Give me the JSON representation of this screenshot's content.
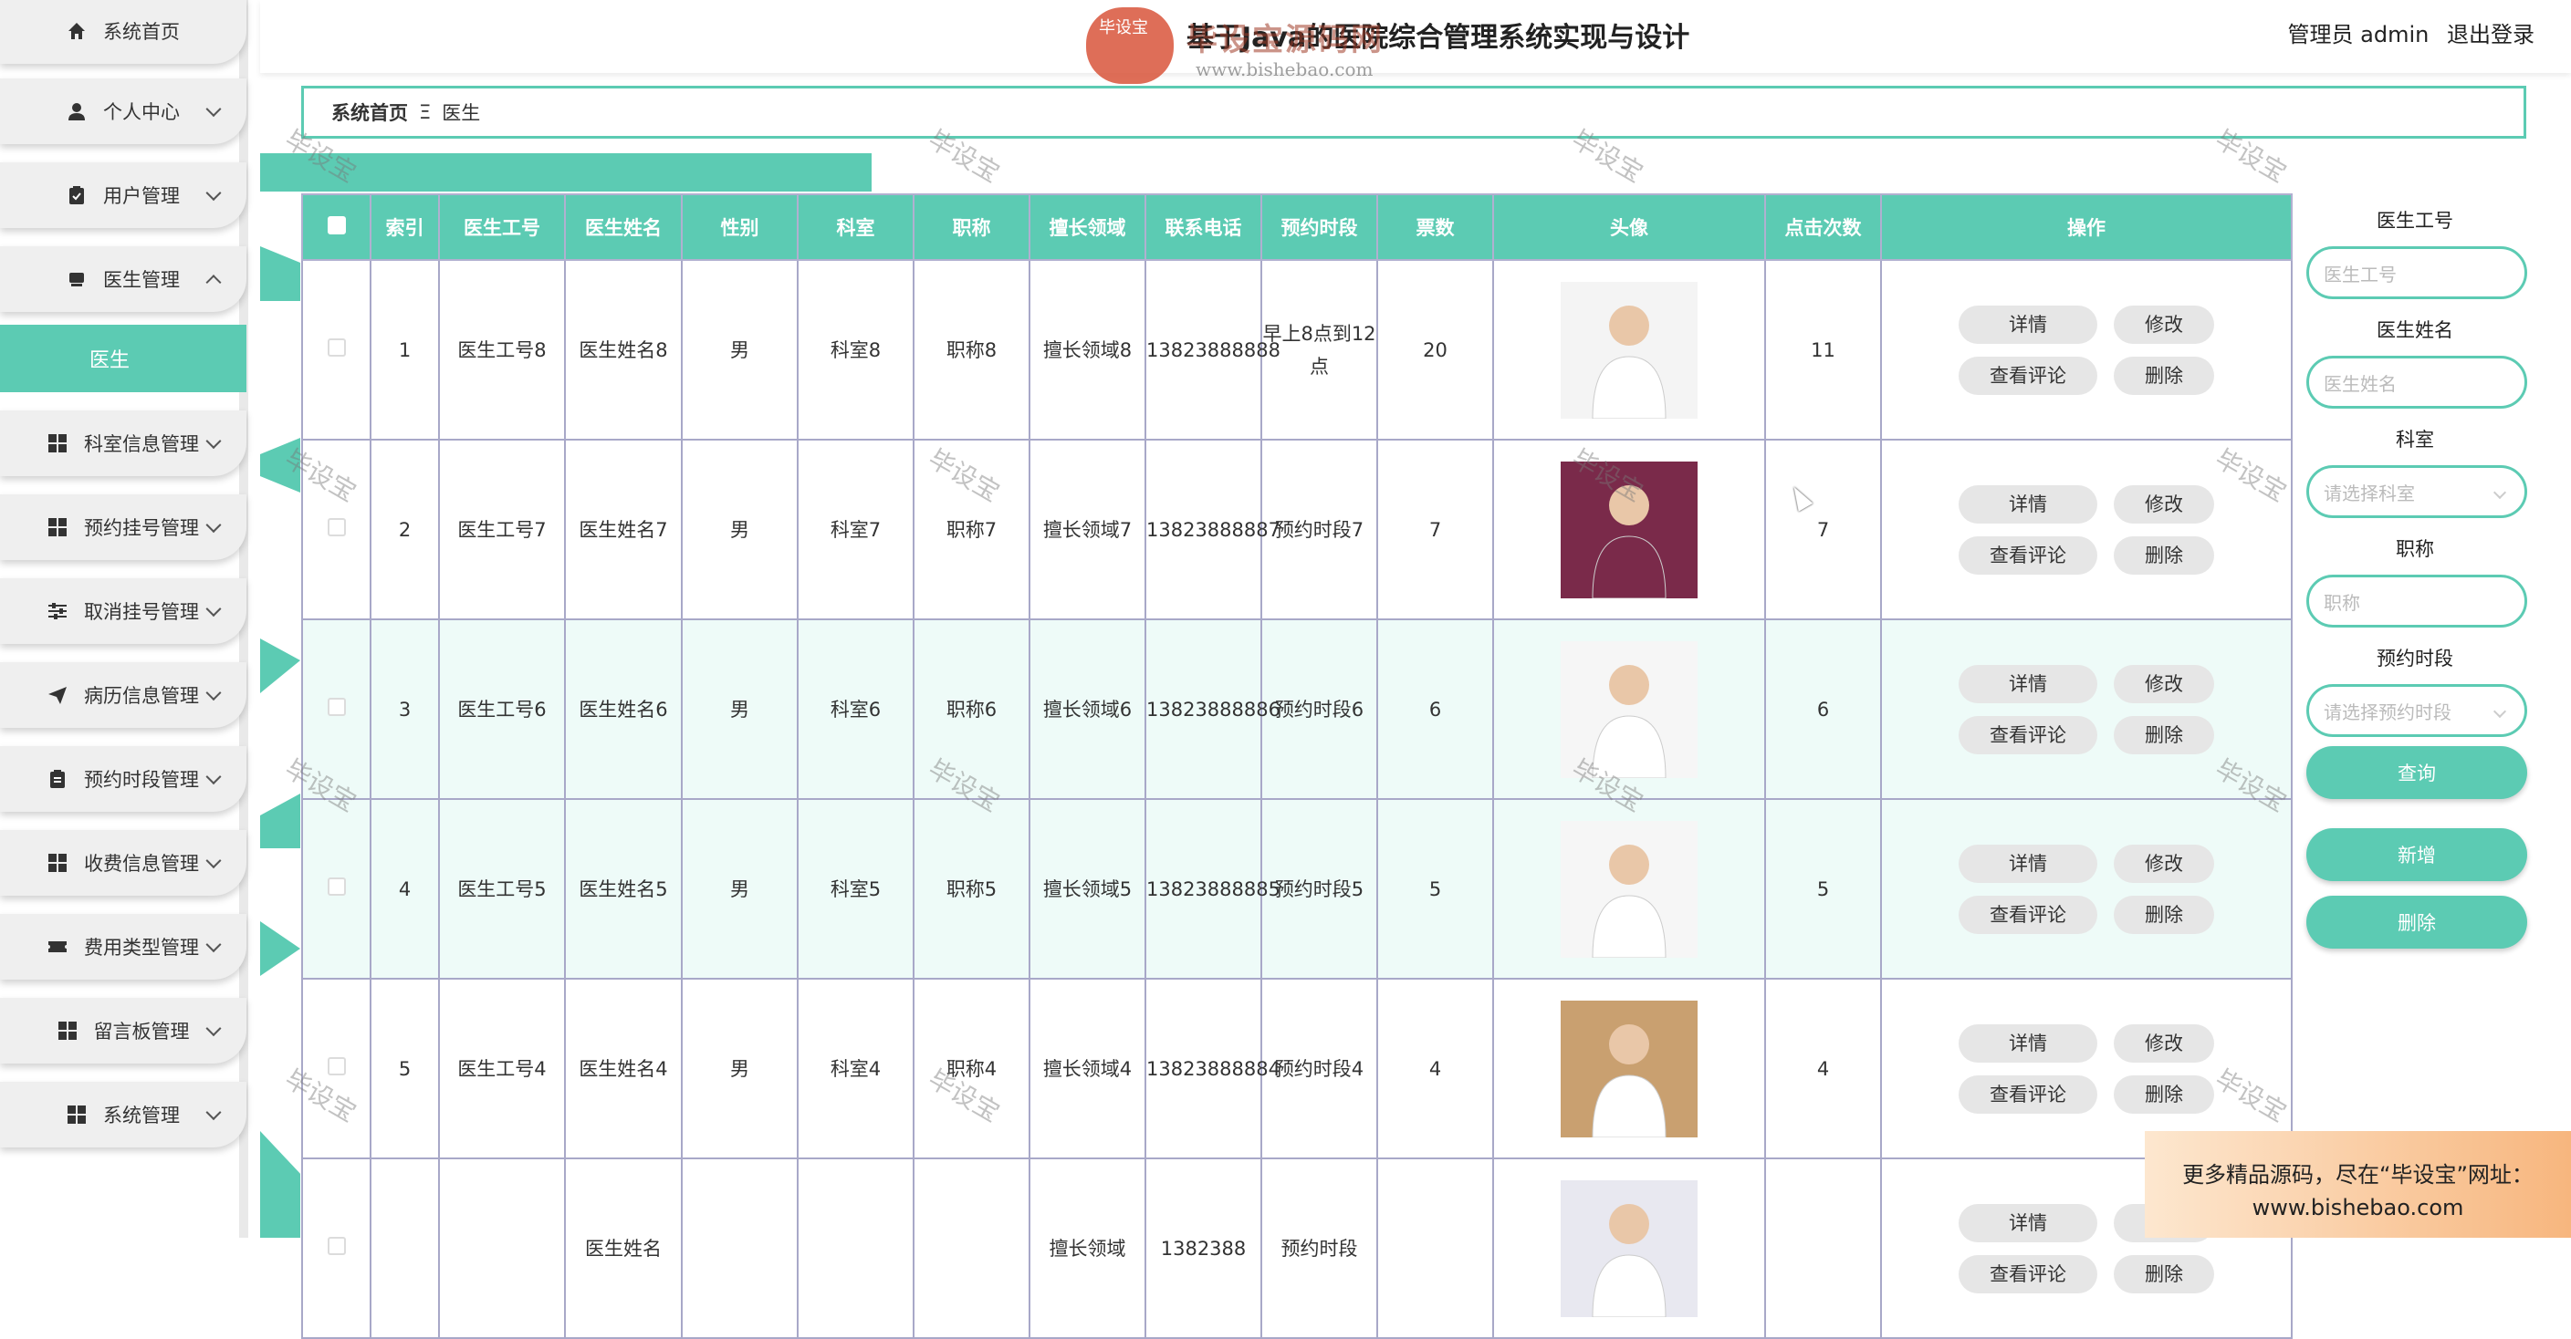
{
  "header": {
    "title": "基于Java的医院综合管理系统实现与设计",
    "logo_badge": "毕设宝",
    "logo_text": "毕设宝源码网",
    "logo_url": "www.bishebao.com",
    "user_label": "管理员 admin",
    "logout_label": "退出登录"
  },
  "sidebar": {
    "items": [
      {
        "label": "系统首页",
        "icon": "home-icon"
      },
      {
        "label": "个人中心",
        "icon": "user-icon"
      },
      {
        "label": "用户管理",
        "icon": "clipboard-icon"
      },
      {
        "label": "医生管理",
        "icon": "doctor-icon"
      },
      {
        "label": "科室信息管理",
        "icon": "grid-icon"
      },
      {
        "label": "预约挂号管理",
        "icon": "grid-icon"
      },
      {
        "label": "取消挂号管理",
        "icon": "sliders-icon"
      },
      {
        "label": "病历信息管理",
        "icon": "send-icon"
      },
      {
        "label": "预约时段管理",
        "icon": "clipboard-icon"
      },
      {
        "label": "收费信息管理",
        "icon": "grid-icon"
      },
      {
        "label": "费用类型管理",
        "icon": "ticket-icon"
      },
      {
        "label": "留言板管理",
        "icon": "grid-icon"
      },
      {
        "label": "系统管理",
        "icon": "grid-icon"
      }
    ],
    "active_submenu": "医生"
  },
  "breadcrumb": {
    "home": "系统首页",
    "separator": "Ξ",
    "current": "医生"
  },
  "table": {
    "headers": [
      "",
      "索引",
      "医生工号",
      "医生姓名",
      "性别",
      "科室",
      "职称",
      "擅长领域",
      "联系电话",
      "预约时段",
      "票数",
      "头像",
      "点击次数",
      "操作"
    ],
    "rows": [
      {
        "index": "1",
        "id": "医生工号8",
        "name": "医生姓名8",
        "gender": "男",
        "dept": "科室8",
        "title": "职称8",
        "field": "擅长领域8",
        "phone": "13823888888",
        "slot": "早上8点到12点",
        "votes": "20",
        "clicks": "11"
      },
      {
        "index": "2",
        "id": "医生工号7",
        "name": "医生姓名7",
        "gender": "男",
        "dept": "科室7",
        "title": "职称7",
        "field": "擅长领域7",
        "phone": "13823888887",
        "slot": "预约时段7",
        "votes": "7",
        "clicks": "7"
      },
      {
        "index": "3",
        "id": "医生工号6",
        "name": "医生姓名6",
        "gender": "男",
        "dept": "科室6",
        "title": "职称6",
        "field": "擅长领域6",
        "phone": "13823888886",
        "slot": "预约时段6",
        "votes": "6",
        "clicks": "6"
      },
      {
        "index": "4",
        "id": "医生工号5",
        "name": "医生姓名5",
        "gender": "男",
        "dept": "科室5",
        "title": "职称5",
        "field": "擅长领域5",
        "phone": "13823888885",
        "slot": "预约时段5",
        "votes": "5",
        "clicks": "5"
      },
      {
        "index": "5",
        "id": "医生工号4",
        "name": "医生姓名4",
        "gender": "男",
        "dept": "科室4",
        "title": "职称4",
        "field": "擅长领域4",
        "phone": "13823888884",
        "slot": "预约时段4",
        "votes": "4",
        "clicks": "4"
      },
      {
        "index": "",
        "id": "",
        "name": "医生姓名",
        "gender": "",
        "dept": "",
        "title": "",
        "field": "擅长领域",
        "phone": "1382388",
        "slot": "预约时段",
        "votes": "",
        "clicks": ""
      }
    ],
    "ops": {
      "detail": "详情",
      "edit": "修改",
      "comments": "查看评论",
      "delete": "删除"
    }
  },
  "search": {
    "doctor_id_label": "医生工号",
    "doctor_id_placeholder": "医生工号",
    "doctor_name_label": "医生姓名",
    "doctor_name_placeholder": "医生姓名",
    "dept_label": "科室",
    "dept_placeholder": "请选择科室",
    "title_label": "职称",
    "title_placeholder": "职称",
    "slot_label": "预约时段",
    "slot_placeholder": "请选择预约时段",
    "query_button": "查询",
    "add_button": "新增",
    "delete_button": "删除"
  },
  "watermark": "毕设宝",
  "promo": {
    "line1": "更多精品源码，尽在“毕设宝”网址：",
    "line2": "www.bishebao.com"
  },
  "colors": {
    "accent": "#5ccbb3",
    "row_alt": "#eefbf8"
  }
}
